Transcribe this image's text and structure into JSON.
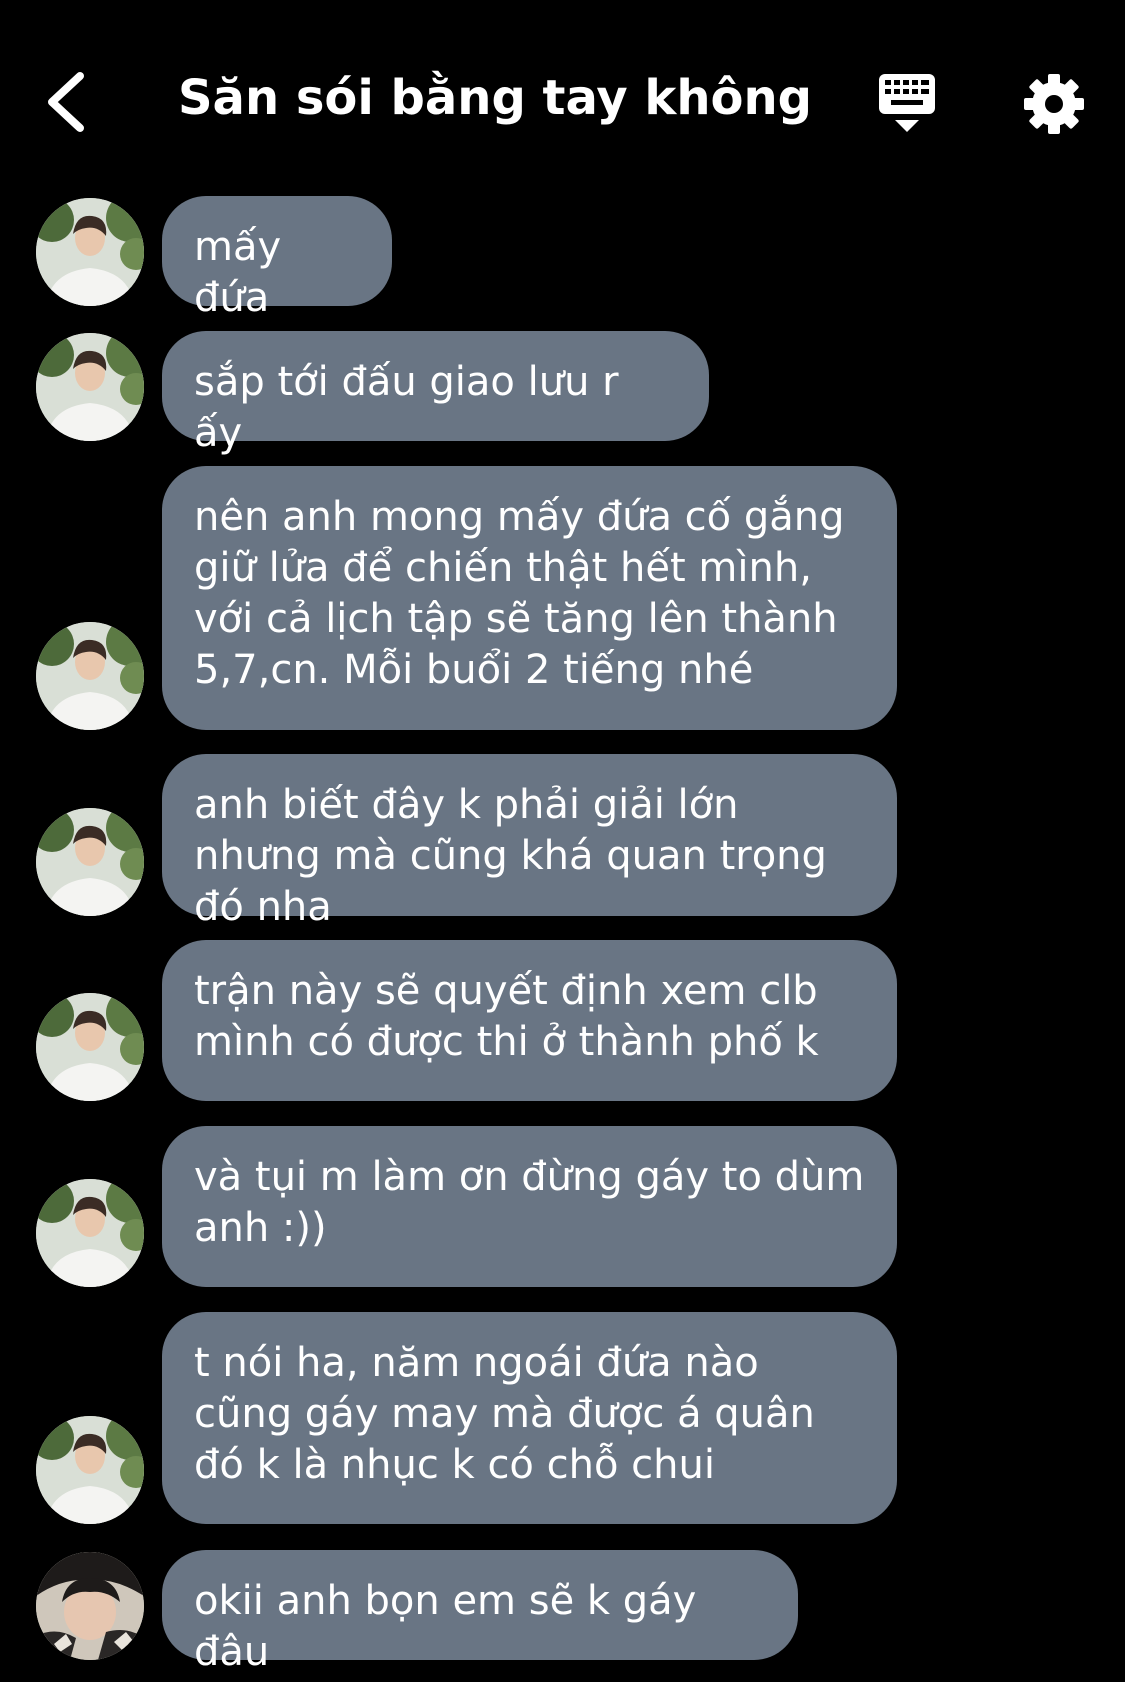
{
  "header": {
    "title": "Săn sói bằng tay không",
    "back_icon": "chevron-left-icon",
    "keyboard_icon": "keyboard-icon",
    "settings_icon": "gear-icon"
  },
  "colors": {
    "background": "#000000",
    "bubble": "#697584",
    "text": "#ffffff"
  },
  "messages": [
    {
      "sender": "leader",
      "text": "mấy đứa"
    },
    {
      "sender": "leader",
      "text": "sắp tới đấu giao lưu r ấy"
    },
    {
      "sender": "leader",
      "text": "nên anh mong mấy đứa cố gắng giữ lửa để chiến thật hết mình, với cả lịch tập sẽ tăng lên thành 5,7,cn. Mỗi buổi 2 tiếng nhé"
    },
    {
      "sender": "leader",
      "text": "anh biết đây k phải giải lớn nhưng mà cũng khá quan trọng đó nha"
    },
    {
      "sender": "leader",
      "text": "trận này sẽ quyết định xem clb mình có được thi ở thành phố k"
    },
    {
      "sender": "leader",
      "text": "và tụi m làm ơn đừng gáy to dùm anh :))"
    },
    {
      "sender": "leader",
      "text": "t nói ha, năm ngoái đứa nào cũng gáy may mà được á quân đó k là nhục k có chỗ chui"
    },
    {
      "sender": "member",
      "text": "okii anh bọn em sẽ k gáy đâu"
    }
  ]
}
